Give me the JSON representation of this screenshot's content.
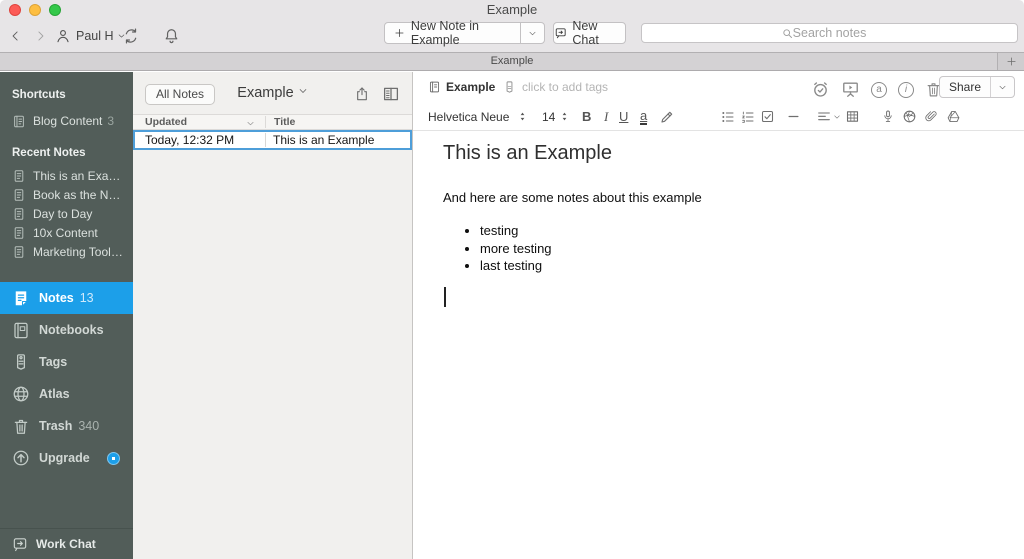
{
  "window": {
    "title": "Example"
  },
  "toolbar": {
    "account_name": "Paul H",
    "new_note_label": "New Note in Example",
    "new_chat_label": "New Chat",
    "search_placeholder": "Search notes"
  },
  "tabbar": {
    "tab_label": "Example"
  },
  "sidebar": {
    "shortcuts_header": "Shortcuts",
    "shortcuts": [
      {
        "label": "Blog Content",
        "count": "3"
      }
    ],
    "recent_header": "Recent Notes",
    "recent": [
      {
        "label": "This is an Exa…"
      },
      {
        "label": "Book as the N…"
      },
      {
        "label": "Day to Day"
      },
      {
        "label": "10x Content"
      },
      {
        "label": "Marketing Tool…"
      }
    ],
    "nav": [
      {
        "label": "Notes",
        "count": "13"
      },
      {
        "label": "Notebooks",
        "count": ""
      },
      {
        "label": "Tags",
        "count": ""
      },
      {
        "label": "Atlas",
        "count": ""
      },
      {
        "label": "Trash",
        "count": "340"
      },
      {
        "label": "Upgrade",
        "count": ""
      }
    ],
    "work_chat_label": "Work Chat"
  },
  "notelist": {
    "all_notes_label": "All Notes",
    "context_title": "Example",
    "columns": {
      "updated": "Updated",
      "title": "Title"
    },
    "rows": [
      {
        "updated": "Today, 12:32 PM",
        "title": "This is an Example"
      }
    ]
  },
  "editor": {
    "notebook_name": "Example",
    "tags_placeholder": "click to add tags",
    "share_label": "Share",
    "format": {
      "font_name": "Helvetica Neue",
      "font_size": "14",
      "bold_glyph": "B",
      "italic_glyph": "I",
      "underline_glyph": "U",
      "color_glyph": "a",
      "annotate_glyph": "a",
      "info_glyph": "i"
    },
    "note": {
      "title": "This is an Example",
      "paragraph": "And here are some notes about this example",
      "bullets": [
        "testing",
        "more testing",
        "last testing"
      ]
    }
  },
  "colors": {
    "accent_blue": "#1c9fe9",
    "sidebar_bg": "#525d59",
    "selection_border": "#4e9ed9"
  }
}
